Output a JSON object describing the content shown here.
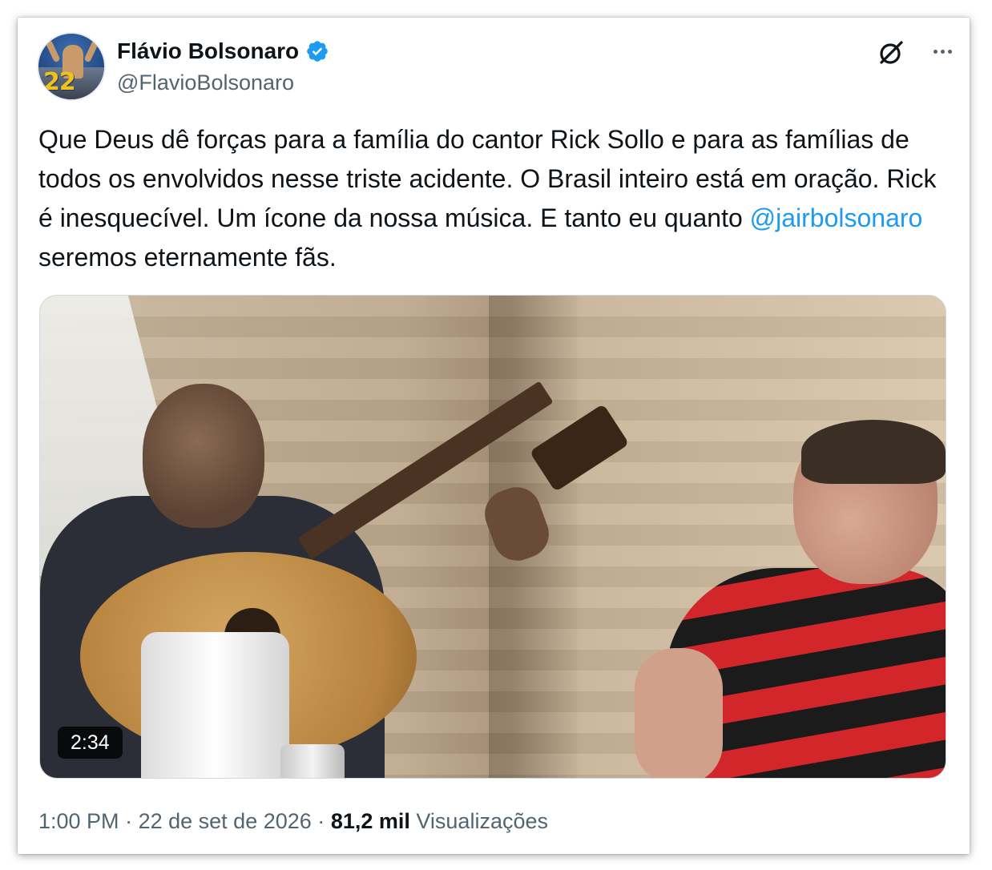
{
  "author": {
    "display_name": "Flávio Bolsonaro",
    "handle": "@FlavioBolsonaro",
    "avatar_badge": "22",
    "verified": true,
    "verified_color": "#1d9bf0"
  },
  "icons": {
    "grok": "grok-icon",
    "more": "more-options-icon",
    "verified": "verified-badge-icon"
  },
  "tweet": {
    "text_before": "Que Deus dê forças para a família do cantor Rick Sollo e para as famílias de todos os envolvidos nesse triste acidente. O Brasil inteiro está em oração. Rick é inesquecível. Um ícone da nossa música. E tanto eu quanto ",
    "mention": "@jairbolsonaro",
    "text_after": " seremos eternamente fãs.",
    "mention_color": "#1d9bf0"
  },
  "media": {
    "type": "video",
    "duration": "2:34"
  },
  "meta": {
    "time": "1:00 PM",
    "separator": "·",
    "date": "22 de set de 2026",
    "views_count": "81,2 mil",
    "views_label": "Visualizações"
  }
}
